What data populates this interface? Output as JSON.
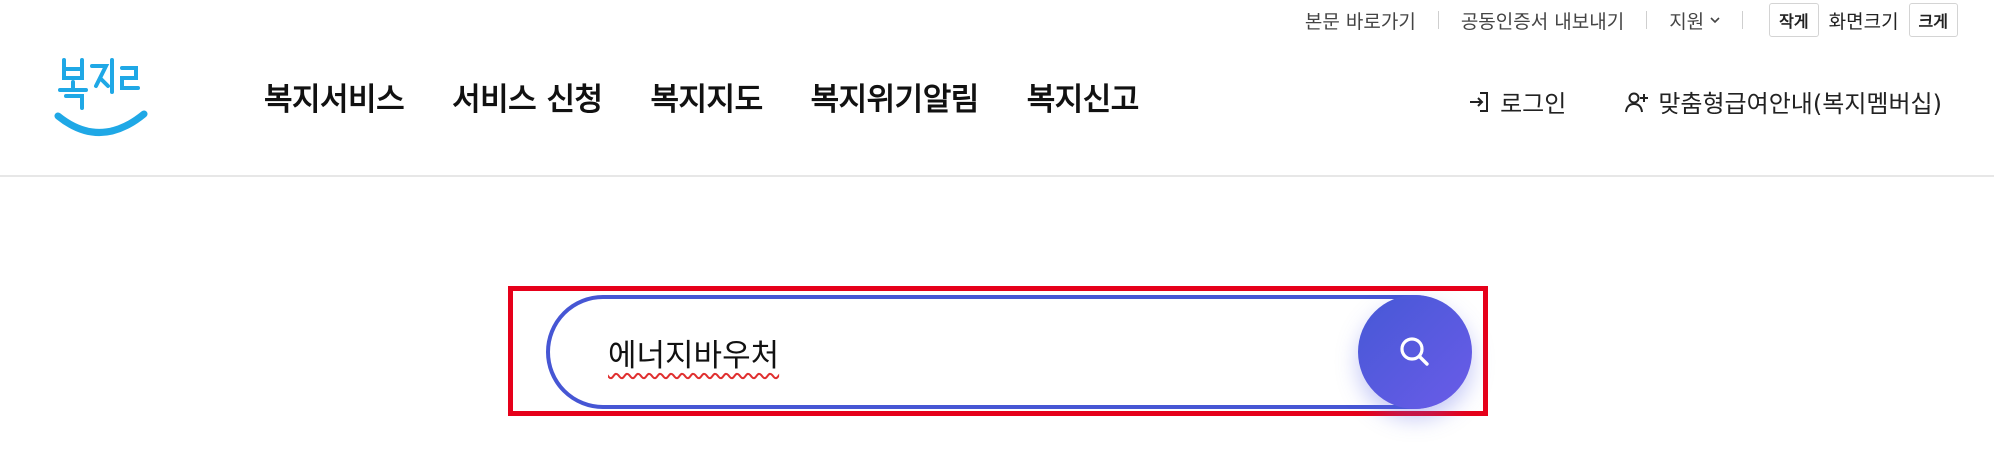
{
  "util": {
    "skip_link": "본문 바로가기",
    "cert_export": "공동인증서 내보내기",
    "support": "지원",
    "font_size_small": "작게",
    "font_size_label": "화면크기",
    "font_size_large": "크게"
  },
  "logo": {
    "text": "복지로",
    "brand_color": "#1fa8e6"
  },
  "gnb": {
    "items": [
      {
        "label": "복지서비스"
      },
      {
        "label": "서비스 신청"
      },
      {
        "label": "복지지도"
      },
      {
        "label": "복지위기알림"
      },
      {
        "label": "복지신고"
      }
    ]
  },
  "member": {
    "login": "로그인",
    "membership": "맞춤형급여안내(복지멤버십)"
  },
  "search": {
    "value": "에너지바우처",
    "accent_color": "#4656d4",
    "highlight_color": "#e6001a"
  },
  "icons": {
    "login": "login-icon",
    "membership": "user-plus-icon",
    "search": "search-icon",
    "chevron": "chevron-down-icon"
  }
}
